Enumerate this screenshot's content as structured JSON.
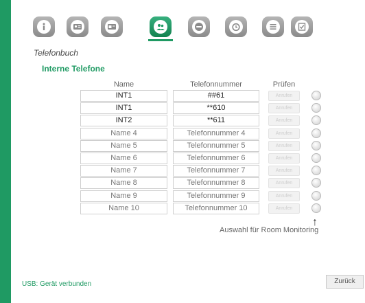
{
  "toolbar": {
    "icons": [
      {
        "name": "info-icon",
        "active": false
      },
      {
        "name": "contact-card-icon",
        "active": false
      },
      {
        "name": "id-card-icon",
        "active": false
      },
      {
        "name": "phonebook-icon",
        "active": true
      },
      {
        "name": "sos-icon",
        "active": false
      },
      {
        "name": "alarm-clock-icon",
        "active": false
      },
      {
        "name": "settings-list-icon",
        "active": false
      },
      {
        "name": "checklist-icon",
        "active": false
      }
    ]
  },
  "page": {
    "title": "Telefonbuch",
    "subtitle": "Interne Telefone"
  },
  "table": {
    "headers": {
      "name": "Name",
      "phone": "Telefonnummer",
      "check": "Prüfen"
    },
    "call_label": "Anrufen",
    "rows": [
      {
        "name": "INT1",
        "phone": "##61",
        "filled": true
      },
      {
        "name": "INT1",
        "phone": "**610",
        "filled": true
      },
      {
        "name": "INT2",
        "phone": "**611",
        "filled": true
      },
      {
        "name": "Name 4",
        "phone": "Telefonnummer 4",
        "filled": false
      },
      {
        "name": "Name 5",
        "phone": "Telefonnummer 5",
        "filled": false
      },
      {
        "name": "Name 6",
        "phone": "Telefonnummer 6",
        "filled": false
      },
      {
        "name": "Name 7",
        "phone": "Telefonnummer 7",
        "filled": false
      },
      {
        "name": "Name 8",
        "phone": "Telefonnummer 8",
        "filled": false
      },
      {
        "name": "Name 9",
        "phone": "Telefonnummer 9",
        "filled": false
      },
      {
        "name": "Name 10",
        "phone": "Telefonnummer 10",
        "filled": false
      }
    ]
  },
  "room_monitoring": {
    "label": "Auswahl für Room Monitoring",
    "arrow": "↑"
  },
  "footer": {
    "usb_status": "USB: Gerät verbunden",
    "back_label": "Zurück"
  },
  "colors": {
    "accent": "#1f9a63",
    "icon_gray": "#9a9a9a"
  }
}
